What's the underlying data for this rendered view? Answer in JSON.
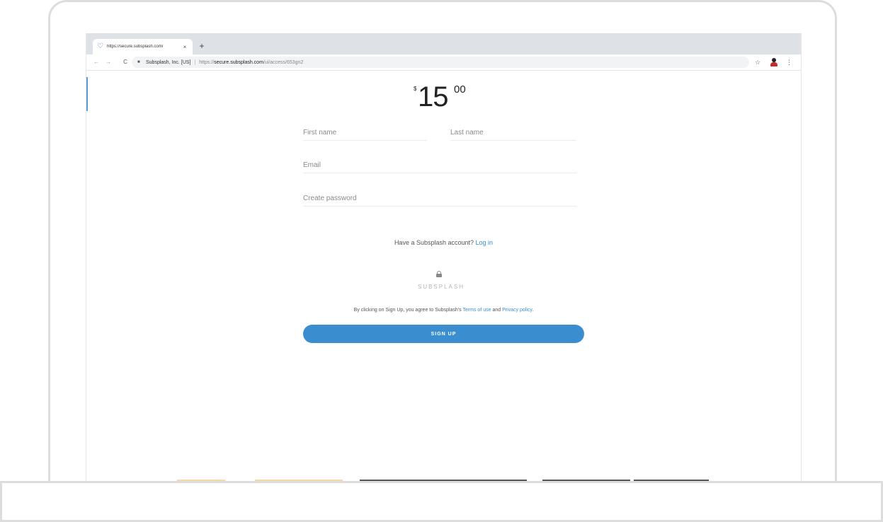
{
  "browser": {
    "tab_title": "https://secure.subsplash.com/",
    "tab_close": "×",
    "new_tab": "+",
    "site_identity": "Subsplash, Inc. [US]",
    "url_scheme": "https://",
    "url_host": "secure.subsplash.com",
    "url_path": "/ui/access/653gn2",
    "separator": "|",
    "nav_back": "←",
    "nav_forward": "→",
    "nav_reload": "C",
    "star": "☆",
    "menu": "⋮"
  },
  "page": {
    "price": {
      "currency": "$",
      "amount": "15",
      "cents": "00"
    },
    "form": {
      "first_name_placeholder": "First name",
      "last_name_placeholder": "Last name",
      "email_placeholder": "Email",
      "password_placeholder": "Create password"
    },
    "account_prompt": "Have a Subsplash account?",
    "login_link": "Log in",
    "brand": "SUBSPLASH",
    "terms_prefix": "By clicking on Sign Up, you agree to Subsplash's",
    "terms_link": "Terms of use",
    "terms_and": "and",
    "privacy_link": "Privacy policy.",
    "signup_label": "SIGN UP"
  },
  "colors": {
    "accent": "#3a8ed0",
    "link": "#3a8fd3",
    "strip_yellow": "#f7d9a6",
    "strip_gray": "#555555"
  }
}
